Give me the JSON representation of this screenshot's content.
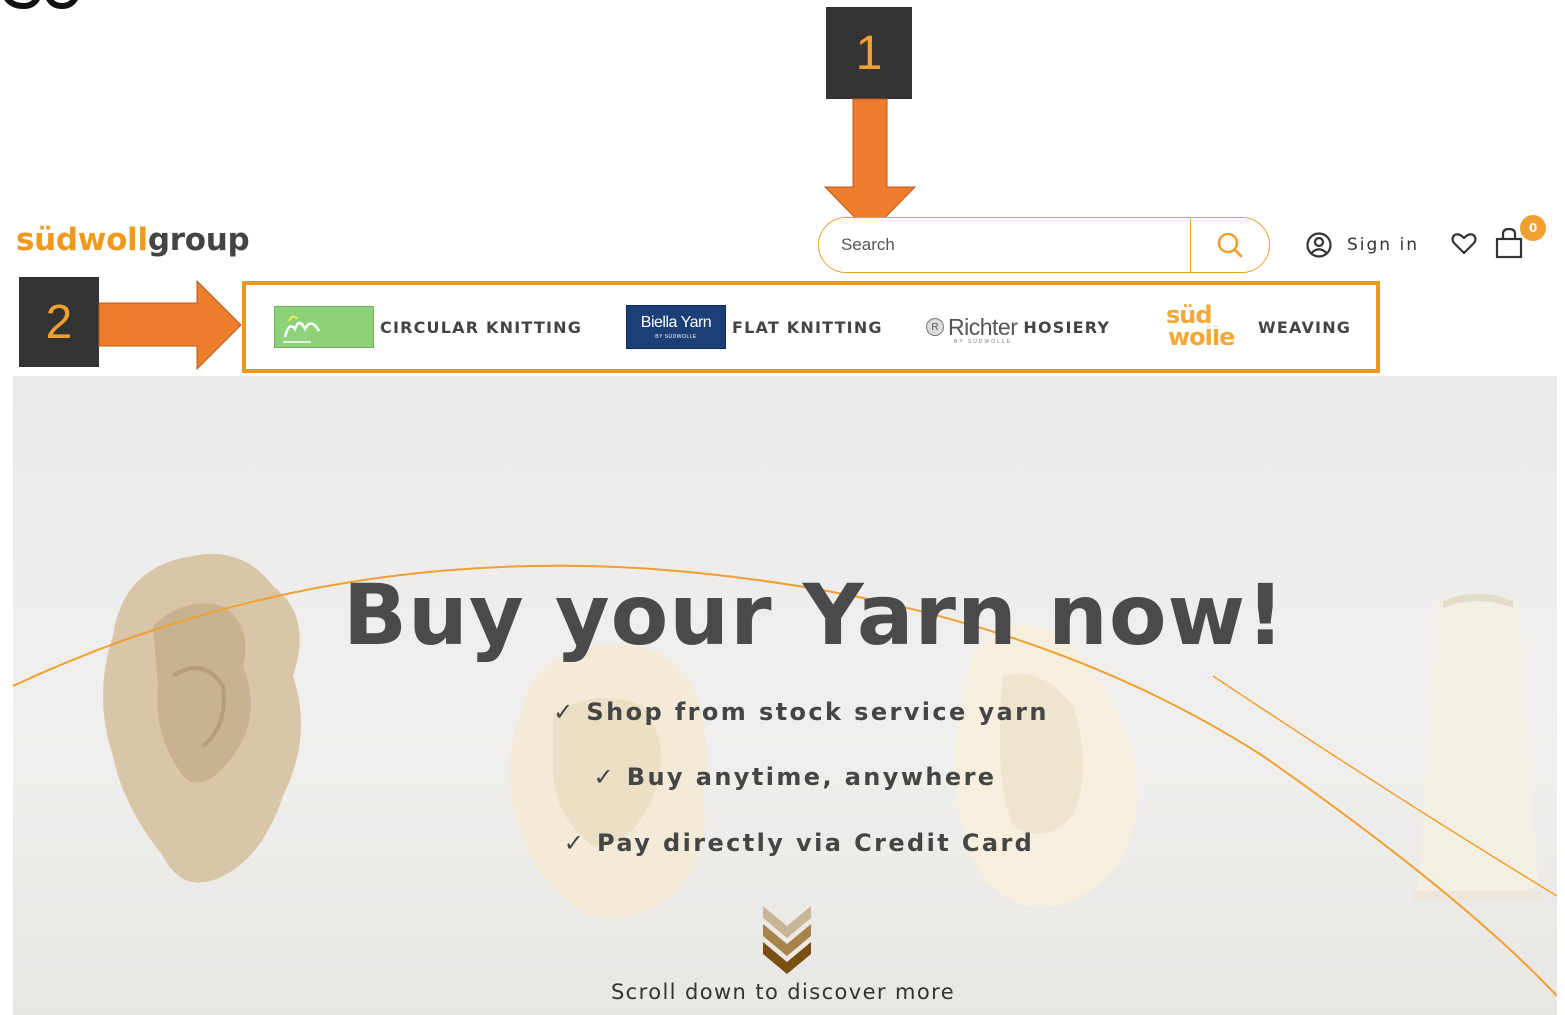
{
  "annotations": {
    "label_1": "1",
    "label_2": "2"
  },
  "header": {
    "logo_part1": "südwoll",
    "logo_part2": "group",
    "search": {
      "placeholder": "Search"
    },
    "signin_label": "Sign in",
    "cart_count": "0"
  },
  "categories": [
    {
      "label": "CIRCULAR KNITTING",
      "brand_logo": "ym-yarn-logo"
    },
    {
      "label": "FLAT KNITTING",
      "brand_logo": "biella-yarn-logo",
      "brand_text": "Biella Yarn",
      "brand_subtext": "BY SÜDWOLLE"
    },
    {
      "label": "HOSIERY",
      "brand_logo": "richter-logo",
      "brand_text": "Richter",
      "brand_mark": "R",
      "brand_subtext": "BY SÜDWOLLE"
    },
    {
      "label": "WEAVING",
      "brand_logo": "sudwolle-logo",
      "brand_text_top": "süd",
      "brand_text_bottom": "wolle"
    }
  ],
  "hero": {
    "title": "Buy your Yarn now!",
    "bullets": [
      "✓ Shop from stock service yarn",
      "✓ Buy anytime, anywhere",
      "✓ Pay directly via Credit Card"
    ],
    "scroll_text": "Scroll down to discover more"
  },
  "colors": {
    "accent": "#f0a030",
    "annotation_bg": "#333333",
    "arrow": "#ee7d2e",
    "text": "#4a4a4a"
  }
}
